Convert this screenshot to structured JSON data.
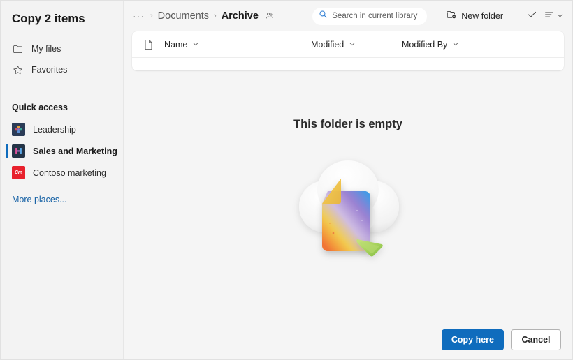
{
  "dialog": {
    "title": "Copy 2 items"
  },
  "sidebar": {
    "nav": [
      {
        "label": "My files",
        "icon": "folder-icon"
      },
      {
        "label": "Favorites",
        "icon": "star-icon"
      }
    ],
    "section_label": "Quick access",
    "quick_access": [
      {
        "label": "Leadership",
        "icon": "leadership-site-icon",
        "selected": false
      },
      {
        "label": "Sales and Marketing",
        "icon": "sales-marketing-site-icon",
        "selected": true
      },
      {
        "label": "Contoso marketing",
        "icon": "contoso-marketing-site-icon",
        "tile_text": "Cm",
        "selected": false
      }
    ],
    "more_places_label": "More places...",
    "accent_color": "#0f6cbd",
    "link_color": "#115ea3"
  },
  "breadcrumb": {
    "overflow": "···",
    "separator": "›",
    "items": [
      {
        "label": "Documents",
        "current": false
      },
      {
        "label": "Archive",
        "current": true
      }
    ],
    "shared_icon": "people-shared-icon"
  },
  "search": {
    "placeholder": "Search in current library",
    "icon": "search-icon",
    "value": ""
  },
  "toolbar": {
    "new_folder_label": "New folder",
    "new_folder_icon": "new-folder-icon",
    "check_icon": "checkmark-icon",
    "view_options_icon": "view-options-icon",
    "chevron_icon": "chevron-down-icon"
  },
  "list": {
    "doc_icon": "document-icon",
    "columns": [
      {
        "label": "Name",
        "sort_icon": "chevron-down-icon"
      },
      {
        "label": "Modified",
        "sort_icon": "chevron-down-icon"
      },
      {
        "label": "Modified By",
        "sort_icon": "chevron-down-icon"
      }
    ],
    "rows": []
  },
  "empty_state": {
    "title": "This folder is empty",
    "illustration": "empty-folder-cloud-document-illustration"
  },
  "actions": {
    "primary_label": "Copy here",
    "secondary_label": "Cancel",
    "primary_color": "#0f6cbd"
  }
}
